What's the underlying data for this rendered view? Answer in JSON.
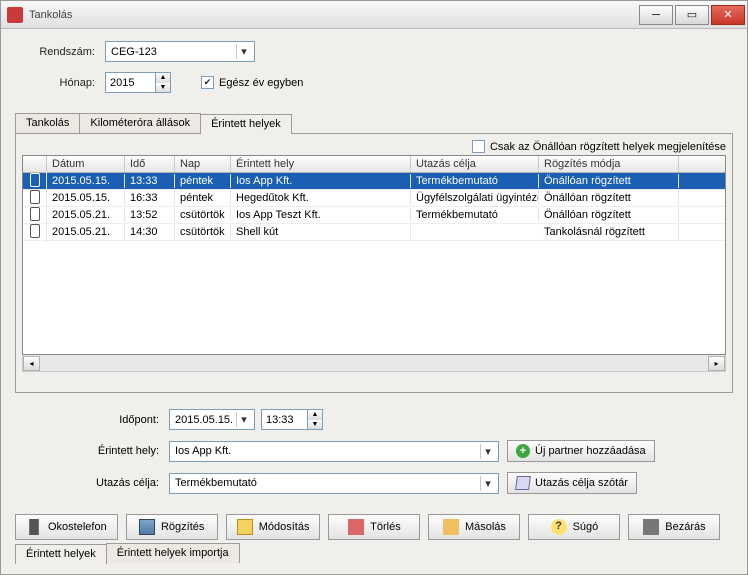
{
  "window": {
    "title": "Tankolás"
  },
  "header": {
    "license_label": "Rendszám:",
    "license_value": "CEG-123",
    "month_label": "Hónap:",
    "year_value": "2015",
    "whole_year_label": "Egész év egyben"
  },
  "tabs": [
    "Tankolás",
    "Kilométeróra állások",
    "Érintett helyek"
  ],
  "filter": {
    "label": "Csak az Önállóan rögzített helyek megjelenítése"
  },
  "grid": {
    "columns": [
      "Dátum",
      "Idő",
      "Nap",
      "Érintett hely",
      "Utazás célja",
      "Rögzítés módja"
    ],
    "rows": [
      {
        "selected": true,
        "date": "2015.05.15.",
        "time": "13:33",
        "day": "péntek",
        "place": "Ios App Kft.",
        "purpose": "Termékbemutató",
        "method": "Önállóan rögzített"
      },
      {
        "selected": false,
        "date": "2015.05.15.",
        "time": "16:33",
        "day": "péntek",
        "place": "Hegedűtok Kft.",
        "purpose": "Ügyfélszolgálati ügyintézés",
        "method": "Önállóan rögzített"
      },
      {
        "selected": false,
        "date": "2015.05.21.",
        "time": "13:52",
        "day": "csütörtök",
        "place": "Ios App Teszt Kft.",
        "purpose": "Termékbemutató",
        "method": "Önállóan rögzített"
      },
      {
        "selected": false,
        "date": "2015.05.21.",
        "time": "14:30",
        "day": "csütörtök",
        "place": "Shell kút",
        "purpose": "",
        "method": "Tankolásnál rögzített"
      }
    ]
  },
  "form": {
    "timestamp_label": "Időpont:",
    "date_value": "2015.05.15.",
    "time_value": "13:33",
    "place_label": "Érintett hely:",
    "place_value": "Ios App Kft.",
    "add_partner": "Új partner hozzáadása",
    "purpose_label": "Utazás célja:",
    "purpose_value": "Termékbemutató",
    "purpose_dict": "Utazás célja szótár"
  },
  "buttons": [
    "Okostelefon",
    "Rögzítés",
    "Módosítás",
    "Törlés",
    "Másolás",
    "Súgó",
    "Bezárás"
  ],
  "bottom_tabs": [
    "Érintett helyek",
    "Érintett helyek importja"
  ]
}
